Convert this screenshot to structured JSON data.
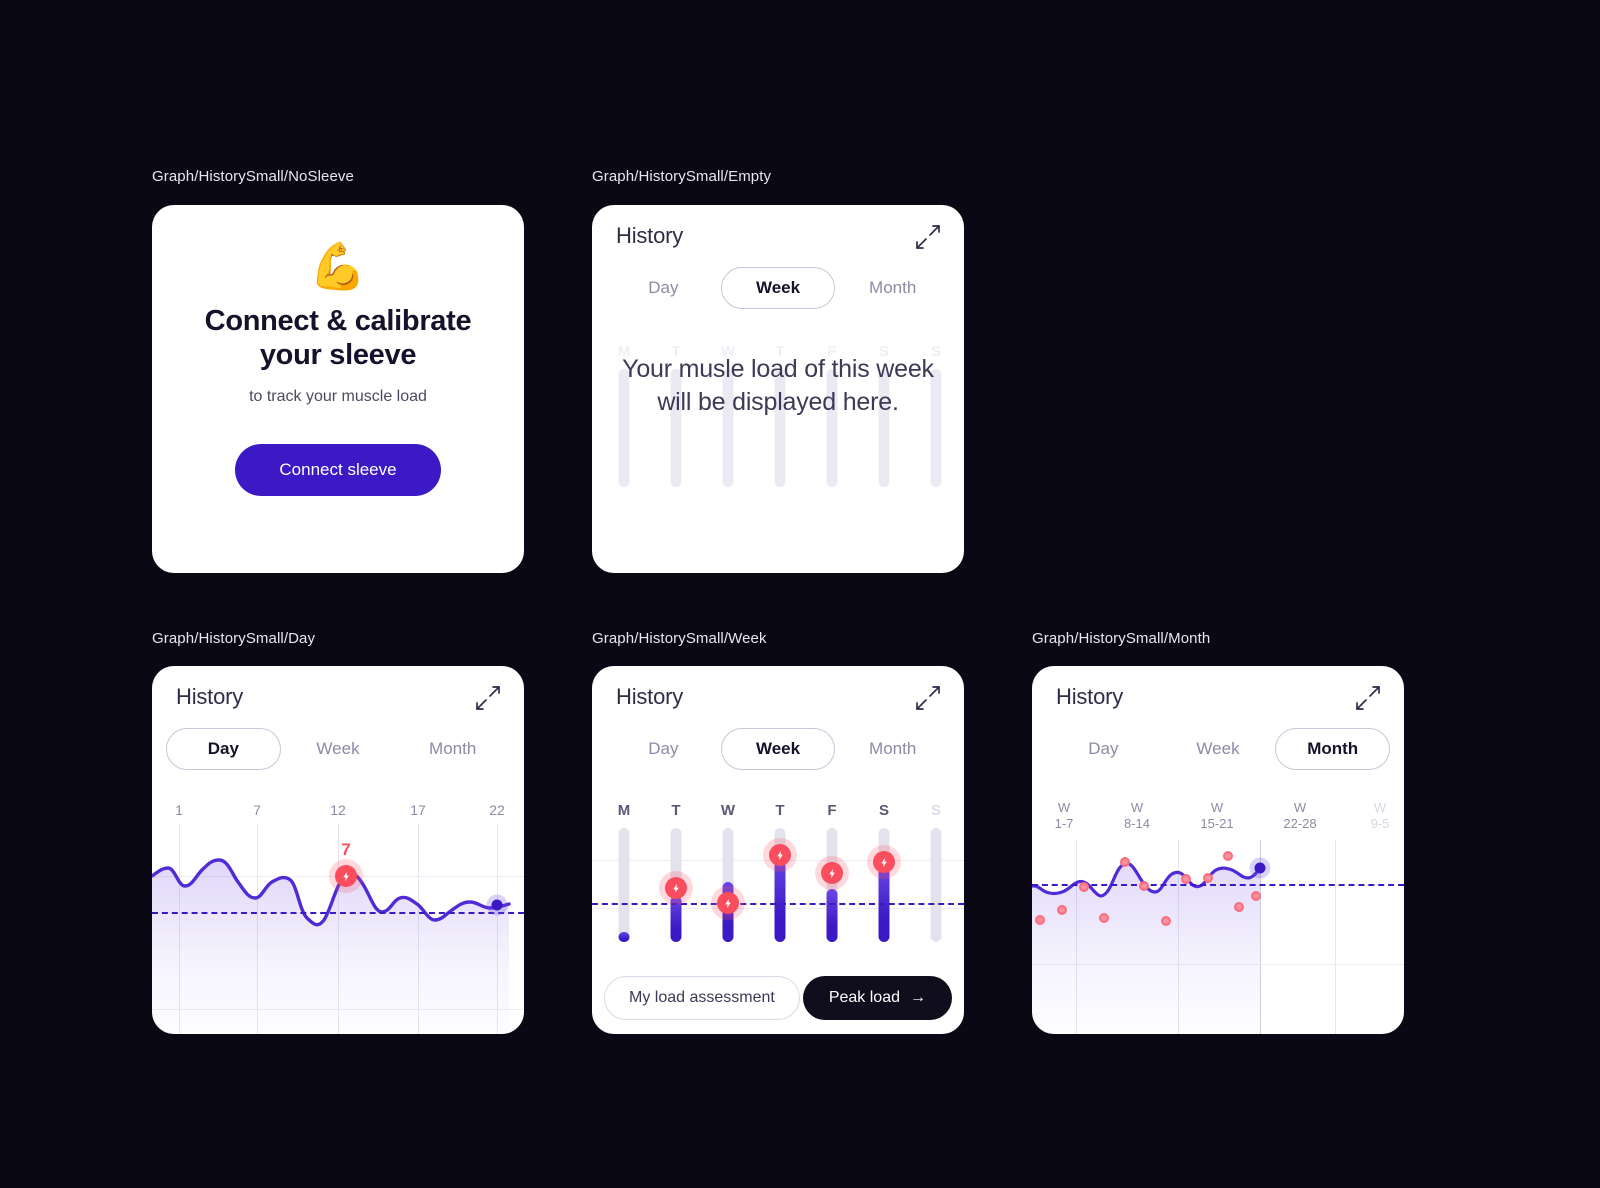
{
  "page": {
    "background": "#0a0814",
    "accent": "#3b19c4",
    "accent_light": "#6b47e6",
    "danger": "#fa4d5e",
    "card_bg": "#ffffff"
  },
  "frames": {
    "nosleeve": {
      "label": "Graph/HistorySmall/NoSleeve"
    },
    "empty": {
      "label": "Graph/HistorySmall/Empty"
    },
    "day": {
      "label": "Graph/HistorySmall/Day"
    },
    "week": {
      "label": "Graph/HistorySmall/Week"
    },
    "month": {
      "label": "Graph/HistorySmall/Month"
    }
  },
  "nosleeve_card": {
    "icon": "flexed-biceps-emoji",
    "icon_glyph": "💪",
    "title": "Connect & calibrate your sleeve",
    "subtitle": "to track your muscle load",
    "button_label": "Connect sleeve"
  },
  "history": {
    "title": "History",
    "expand_icon": "expand-arrows-icon",
    "tabs": [
      {
        "label": "Day"
      },
      {
        "label": "Week"
      },
      {
        "label": "Month"
      }
    ]
  },
  "empty_card": {
    "active_tab": "Week",
    "message": "Your musle load of this week will be displayed here.",
    "day_labels": [
      "M",
      "T",
      "W",
      "T",
      "F",
      "S",
      "S"
    ]
  },
  "day_card": {
    "active_tab": "Day",
    "peak_value": "7",
    "peak_icon": "lightning-bolt-icon"
  },
  "week_card": {
    "active_tab": "Week",
    "day_labels": [
      "M",
      "T",
      "W",
      "T",
      "F",
      "S",
      "S"
    ],
    "footer": {
      "assessment_label": "My load assessment",
      "peak_label": "Peak load",
      "peak_arrow": "→"
    }
  },
  "month_card": {
    "active_tab": "Month",
    "week_labels": [
      {
        "top": "W",
        "bottom": "1-7"
      },
      {
        "top": "W",
        "bottom": "8-14"
      },
      {
        "top": "W",
        "bottom": "15-21"
      },
      {
        "top": "W",
        "bottom": "22-28"
      },
      {
        "top": "W",
        "bottom": "9-5"
      }
    ]
  },
  "chart_data": [
    {
      "id": "day-chart",
      "type": "line",
      "title": "History - Day",
      "xlabel": "",
      "ylabel": "",
      "grid": true,
      "legend": false,
      "tick_labels": [
        "1",
        "7",
        "12",
        "17",
        "22"
      ],
      "tick_x": [
        1,
        7,
        12,
        17,
        22
      ],
      "xlim": [
        0,
        23
      ],
      "ylim": [
        0,
        10
      ],
      "threshold": 4.6,
      "annotations": [
        {
          "x": 13.2,
          "y": 7,
          "label": "7",
          "icon": "lightning-bolt-icon",
          "color": "#fa4d5e"
        }
      ],
      "end_marker": {
        "x": 22,
        "y": 4.0
      },
      "x": [
        0,
        0.6,
        1.6,
        2.4,
        3.4,
        4.4,
        5.4,
        6.4,
        7.2,
        8.2,
        9.2,
        10.2,
        11.2,
        12.2,
        13.2,
        14.2,
        15.2,
        16.2,
        17.2,
        18.2,
        19.2,
        20.2,
        21.2,
        22
      ],
      "values": [
        6.0,
        6.3,
        5.3,
        5.7,
        6.6,
        6.4,
        5.5,
        4.8,
        5.4,
        5.8,
        4.5,
        3.3,
        3.3,
        5.0,
        7.0,
        5.6,
        4.2,
        4.4,
        4.8,
        4.3,
        3.7,
        4.0,
        4.3,
        4.0
      ]
    },
    {
      "id": "week-chart",
      "type": "bar",
      "title": "History - Week",
      "xlabel": "",
      "ylabel": "",
      "grid": true,
      "legend": false,
      "categories": [
        "M",
        "T",
        "W",
        "T",
        "F",
        "S",
        "S"
      ],
      "ylim": [
        0,
        10
      ],
      "threshold": 3.0,
      "track_max": 8.0,
      "values": [
        0.35,
        3.3,
        4.6,
        6.5,
        3.9,
        5.6,
        0
      ],
      "peaks": [
        null,
        3.9,
        3.2,
        7.0,
        4.8,
        6.1,
        null
      ],
      "peak_icon": "lightning-bolt-icon"
    },
    {
      "id": "month-chart",
      "type": "line",
      "title": "History - Month",
      "xlabel": "",
      "ylabel": "",
      "grid": true,
      "legend": false,
      "tick_labels": [
        "W 1-7",
        "W 8-14",
        "W 15-21",
        "W 22-28",
        "W 9-5"
      ],
      "xlim": [
        0,
        20
      ],
      "ylim": [
        0,
        10
      ],
      "threshold": 5.0,
      "end_marker": {
        "x": 11.8,
        "y": 6.5
      },
      "x": [
        0,
        0.8,
        1.8,
        2.6,
        3.4,
        4.2,
        5.0,
        5.8,
        6.6,
        7.4,
        8.2,
        9.0,
        9.8,
        10.6,
        11.2,
        11.8
      ],
      "values": [
        4.9,
        4.6,
        4.9,
        4.7,
        5.2,
        4.6,
        6.3,
        5.1,
        4.2,
        5.4,
        5.5,
        6.1,
        6.5,
        6.0,
        5.8,
        6.5
      ],
      "scatter": [
        {
          "x": 0.35,
          "y": 3.4
        },
        {
          "x": 1.3,
          "y": 4.0
        },
        {
          "x": 2.35,
          "y": 4.9
        },
        {
          "x": 3.3,
          "y": 3.5
        },
        {
          "x": 4.45,
          "y": 6.6
        },
        {
          "x": 5.4,
          "y": 5.0
        },
        {
          "x": 6.35,
          "y": 3.3
        },
        {
          "x": 7.3,
          "y": 5.7
        },
        {
          "x": 8.4,
          "y": 5.7
        },
        {
          "x": 9.2,
          "y": 7.1
        },
        {
          "x": 10.1,
          "y": 3.9
        },
        {
          "x": 10.9,
          "y": 4.5
        }
      ]
    }
  ]
}
